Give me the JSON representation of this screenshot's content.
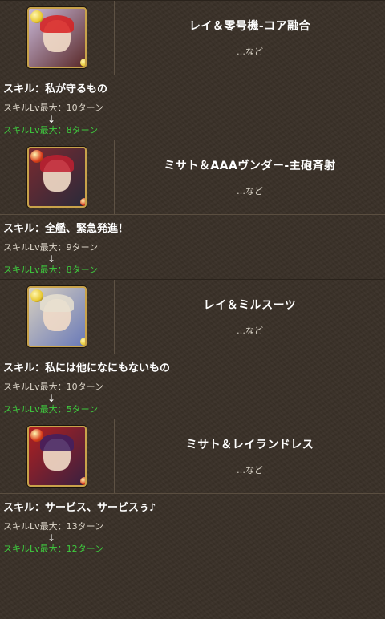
{
  "entries": [
    {
      "name": "レイ＆零号機-コア融合",
      "etc": "…など",
      "skill_title": "スキル：私が守るもの",
      "before": "スキルLv最大：10ターン",
      "arrow": "↓",
      "after": "スキルLv最大：8ターン",
      "colors": {
        "bg1": "#c9b8d8",
        "bg2": "#5a2a2a",
        "orb": "#e8c830",
        "accent": "#d82020"
      }
    },
    {
      "name": "ミサト＆AAAヴンダー-主砲斉射",
      "etc": "…など",
      "skill_title": "スキル：全艦、緊急発進！",
      "before": "スキルLv最大：9ターン",
      "arrow": "↓",
      "after": "スキルLv最大：8ターン",
      "colors": {
        "bg1": "#7a2a30",
        "bg2": "#2a2a3a",
        "orb": "#d83a1a",
        "accent": "#c02030"
      }
    },
    {
      "name": "レイ＆ミルスーツ",
      "etc": "…など",
      "skill_title": "スキル：私には他になにもないもの",
      "before": "スキルLv最大：10ターン",
      "arrow": "↓",
      "after": "スキルLv最大：5ターン",
      "colors": {
        "bg1": "#d8d0c0",
        "bg2": "#6a7ab8",
        "orb": "#e8c830",
        "accent": "#e8e0d0"
      }
    },
    {
      "name": "ミサト＆レイランドレス",
      "etc": "…など",
      "skill_title": "スキル：サービス、サービスぅ♪",
      "before": "スキルLv最大：13ターン",
      "arrow": "↓",
      "after": "スキルLv最大：12ターン",
      "colors": {
        "bg1": "#b02020",
        "bg2": "#3a2040",
        "orb": "#d83a1a",
        "accent": "#402060"
      }
    }
  ]
}
